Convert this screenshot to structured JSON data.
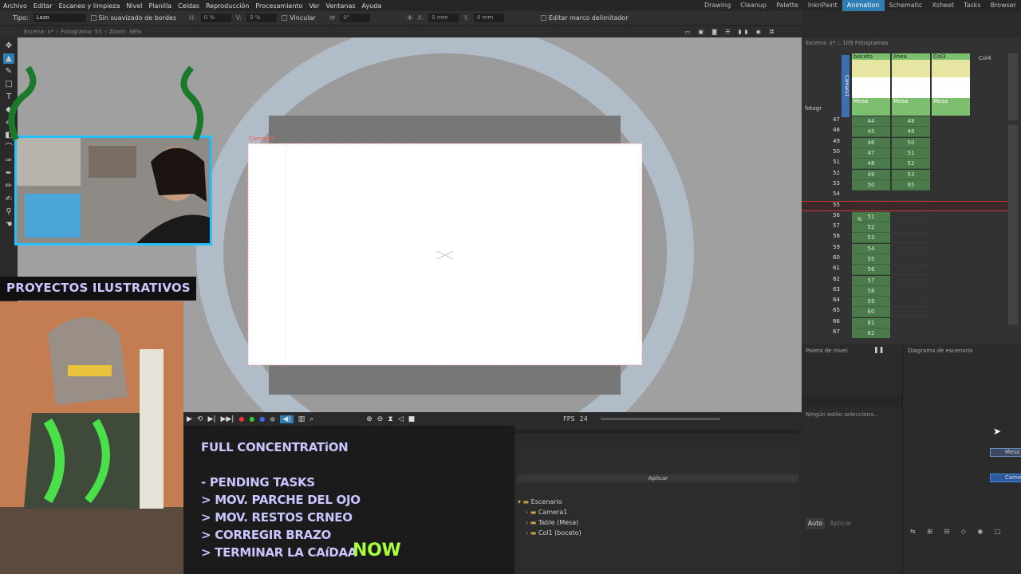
{
  "menu": [
    "Archivo",
    "Editar",
    "Escaneo y limpieza",
    "Nivel",
    "Planilla",
    "Celdas",
    "Reproducción",
    "Procesamiento",
    "Ver",
    "Ventanas",
    "Ayuda"
  ],
  "rooms": [
    {
      "label": "Drawing",
      "active": false
    },
    {
      "label": "Cleanup",
      "active": false
    },
    {
      "label": "Palette",
      "active": false
    },
    {
      "label": "InknPaint",
      "active": false
    },
    {
      "label": "Animation",
      "active": true
    },
    {
      "label": "Schematic",
      "active": false
    },
    {
      "label": "Xsheet",
      "active": false
    },
    {
      "label": "Tasks",
      "active": false
    },
    {
      "label": "Browser",
      "active": false
    }
  ],
  "tool_options": {
    "type_label": "Tipo:",
    "type_value": "Lazo",
    "smoothing_label": "Sin suavizado de bordes",
    "h_label": "H:",
    "h_value": "0 %",
    "v_label": "V:",
    "v_value": "0 %",
    "link_label": "Vincular",
    "rot_value": "0°",
    "x_label": "X:",
    "x_value": "0 mm",
    "y_label": "Y:",
    "y_value": "0 mm",
    "edit_bbox_label": "Editar marco delimitador"
  },
  "viewer": {
    "header": "Escena: x*  ::  Fotograma: 55  ::  Zoom: 38%",
    "camera_label": "Camera1"
  },
  "playback": {
    "fps_label": "FPS",
    "fps_value": "24"
  },
  "overlay": {
    "project_title": "PROYECTOS ILUSTRATIVOS",
    "concentration": "FULL CONCENTRATiON",
    "pending": "- PENDING TASKS",
    "tasks": [
      "> MOV. PARCHE DEL OJO",
      "> MOV. RESTOS CRNEO",
      "> CORREGIR BRAZO",
      "> TERMINAR LA CAíDAA"
    ],
    "now": "NOW"
  },
  "schematic": {
    "apply_label": "Aplicar",
    "tree_root": "Escenario",
    "tree_items": [
      "Camera1",
      "Table (Mesa)",
      "Col1 (boceto)"
    ]
  },
  "xsheet": {
    "header": "Escena: x*  ::  109 Fotogramas",
    "columns": [
      {
        "name": "boceto",
        "foot": "Mesa"
      },
      {
        "name": "línea",
        "foot": "Mesa"
      },
      {
        "name": "Col3",
        "foot": "Mesa"
      },
      {
        "name": "Col4",
        "foot": ""
      }
    ],
    "camera_column": "Cámara1",
    "frame_mode": "fotogr",
    "rows": [
      {
        "f": "47",
        "a": "44",
        "b": "48"
      },
      {
        "f": "48",
        "a": "45",
        "b": "49"
      },
      {
        "f": "49",
        "a": "46",
        "b": "50"
      },
      {
        "f": "50",
        "a": "47",
        "b": "51"
      },
      {
        "f": "51",
        "a": "48",
        "b": "52"
      },
      {
        "f": "52",
        "a": "49",
        "b": "53"
      },
      {
        "f": "53",
        "a": "50",
        "b": "65"
      },
      {
        "f": "54",
        "a": "",
        "b": ""
      },
      {
        "f": "55",
        "a": "",
        "b": ""
      },
      {
        "f": "56",
        "a": "51",
        "b": ""
      },
      {
        "f": "57",
        "a": "52",
        "b": ""
      },
      {
        "f": "58",
        "a": "53",
        "b": ""
      },
      {
        "f": "59",
        "a": "54",
        "b": ""
      },
      {
        "f": "60",
        "a": "55",
        "b": ""
      },
      {
        "f": "61",
        "a": "56",
        "b": ""
      },
      {
        "f": "62",
        "a": "57",
        "b": ""
      },
      {
        "f": "63",
        "a": "58",
        "b": ""
      },
      {
        "f": "64",
        "a": "59",
        "b": ""
      },
      {
        "f": "65",
        "a": "60",
        "b": ""
      },
      {
        "f": "66",
        "a": "61",
        "b": ""
      },
      {
        "f": "67",
        "a": "62",
        "b": ""
      }
    ],
    "current_frame": "55",
    "marker_n": "N"
  },
  "level_palette": {
    "title": "Paleta de nivel:",
    "status": "Ningún estilo selecciona..."
  },
  "scene_diagram": {
    "title": "Diagrama de escenario",
    "node_table": "Mesa",
    "node_camera": "Came"
  },
  "style_editor": {
    "auto_label": "Auto",
    "apply_label": "Aplicar"
  },
  "colors": {
    "accent": "#2f7fb4",
    "cam_border": "#27c0ff",
    "task_text": "#c9c5ff",
    "now_text": "#a6ff3a",
    "xsheet_cell": "#4b7a4b",
    "camera_outline": "#ff3b3b"
  }
}
